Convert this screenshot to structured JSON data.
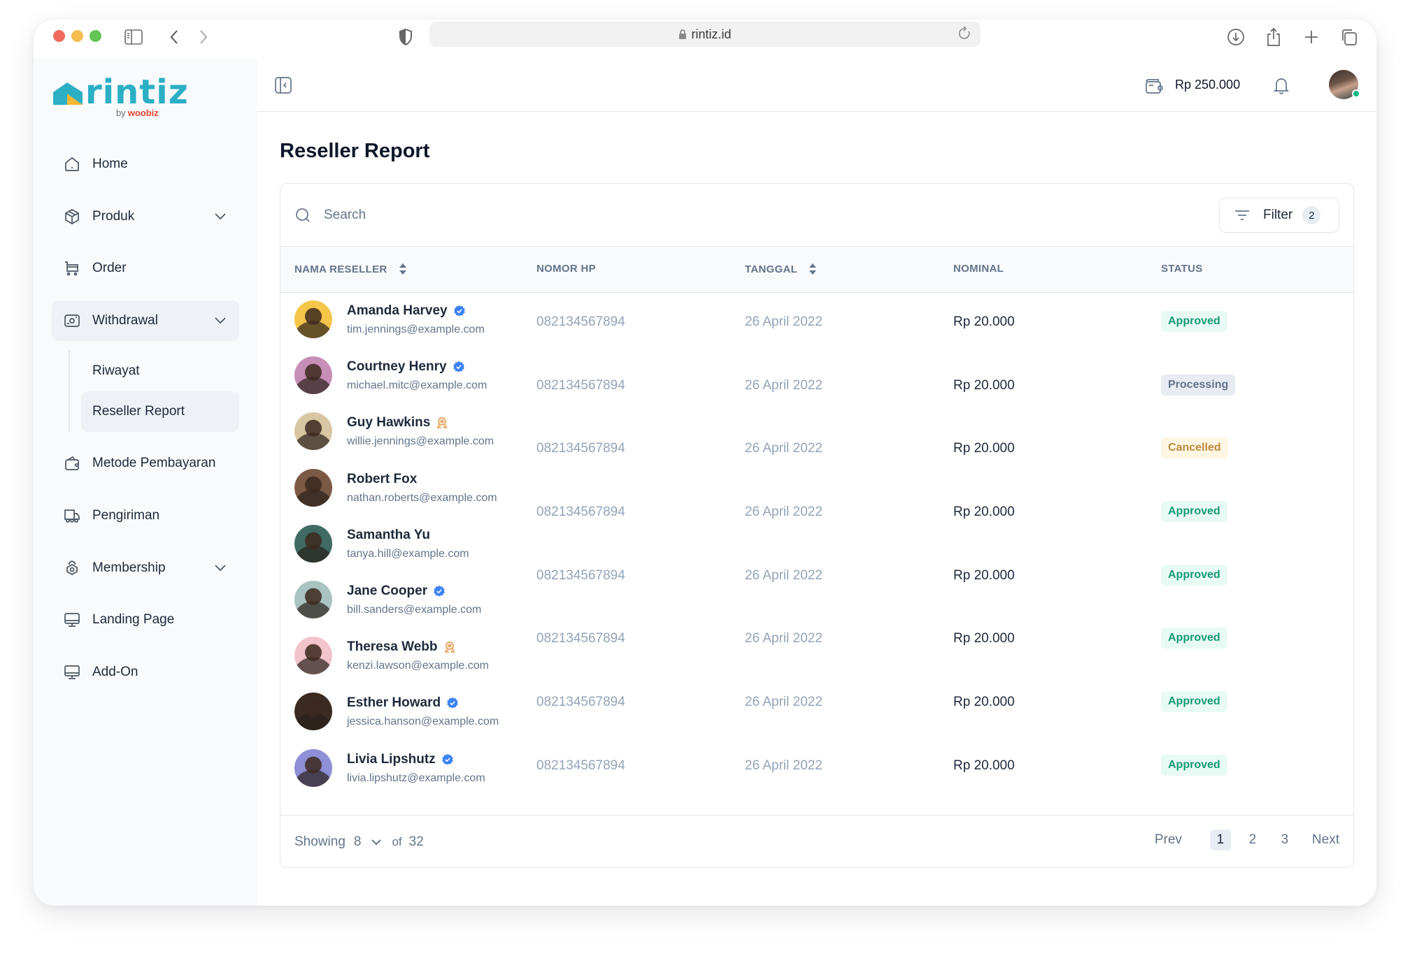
{
  "browser": {
    "url": "rintiz.id"
  },
  "brand": {
    "name": "rintiz",
    "by_label": "by",
    "by_brand": "woobiz",
    "colors": {
      "primary": "#2bafc5",
      "accent": "#f5b731",
      "by": "#e5432f"
    }
  },
  "sidebar": {
    "items": [
      {
        "label": "Home",
        "icon": "home-icon",
        "has_chevron": false
      },
      {
        "label": "Produk",
        "icon": "box-icon",
        "has_chevron": true
      },
      {
        "label": "Order",
        "icon": "cart-icon",
        "has_chevron": false
      },
      {
        "label": "Withdrawal",
        "icon": "camera-wallet-icon",
        "has_chevron": true,
        "expanded": true,
        "children": [
          {
            "label": "Riwayat"
          },
          {
            "label": "Reseller Report",
            "active": true
          }
        ]
      },
      {
        "label": "Metode Pembayaran",
        "icon": "wallet-icon",
        "has_chevron": false
      },
      {
        "label": "Pengiriman",
        "icon": "truck-icon",
        "has_chevron": false
      },
      {
        "label": "Membership",
        "icon": "membership-badge-icon",
        "has_chevron": true
      },
      {
        "label": "Landing Page",
        "icon": "monitor-icon",
        "has_chevron": false
      },
      {
        "label": "Add-On",
        "icon": "monitor-icon",
        "has_chevron": false
      }
    ]
  },
  "header": {
    "balance": "Rp 250.000",
    "online_status_color": "#10b981"
  },
  "page": {
    "title": "Reseller Report",
    "search_placeholder": "Search",
    "filter_label": "Filter",
    "filter_count": "2"
  },
  "table": {
    "columns": [
      {
        "label": "NAMA RESELLER",
        "sortable": true
      },
      {
        "label": "NOMOR HP",
        "sortable": false
      },
      {
        "label": "TANGGAL",
        "sortable": true
      },
      {
        "label": "NOMINAL",
        "sortable": false
      },
      {
        "label": "STATUS",
        "sortable": false
      }
    ],
    "resellers": [
      {
        "name": "Amanda Harvey",
        "email": "tim.jennings@example.com",
        "badge": "verified",
        "avatar_bg": "#f6c64a"
      },
      {
        "name": "Courtney Henry",
        "email": "michael.mitc@example.com",
        "badge": "verified",
        "avatar_bg": "#c78fb8"
      },
      {
        "name": "Guy Hawkins",
        "email": "willie.jennings@example.com",
        "badge": "award",
        "avatar_bg": "#d9c7a3"
      },
      {
        "name": "Robert Fox",
        "email": "nathan.roberts@example.com",
        "badge": "none",
        "avatar_bg": "#7a5a45"
      },
      {
        "name": "Samantha Yu",
        "email": "tanya.hill@example.com",
        "badge": "none",
        "avatar_bg": "#3f6b63"
      },
      {
        "name": "Jane Cooper",
        "email": "bill.sanders@example.com",
        "badge": "verified",
        "avatar_bg": "#a8c3c0"
      },
      {
        "name": "Theresa Webb",
        "email": "kenzi.lawson@example.com",
        "badge": "award",
        "avatar_bg": "#f2c4cc"
      },
      {
        "name": "Esther Howard",
        "email": "jessica.hanson@example.com",
        "badge": "verified",
        "avatar_bg": "#3a2a22"
      },
      {
        "name": "Livia Lipshutz",
        "email": "livia.lipshutz@example.com",
        "badge": "verified",
        "avatar_bg": "#8e8fd6"
      }
    ],
    "rows": [
      {
        "phone": "082134567894",
        "date": "26 April 2022",
        "nominal": "Rp 20.000",
        "status": "Approved",
        "status_type": "approved"
      },
      {
        "phone": "082134567894",
        "date": "26 April 2022",
        "nominal": "Rp 20.000",
        "status": "Processing",
        "status_type": "processing"
      },
      {
        "phone": "082134567894",
        "date": "26 April 2022",
        "nominal": "Rp 20.000",
        "status": "Cancelled",
        "status_type": "cancelled"
      },
      {
        "phone": "082134567894",
        "date": "26 April 2022",
        "nominal": "Rp 20.000",
        "status": "Approved",
        "status_type": "approved"
      },
      {
        "phone": "082134567894",
        "date": "26 April 2022",
        "nominal": "Rp 20.000",
        "status": "Approved",
        "status_type": "approved"
      },
      {
        "phone": "082134567894",
        "date": "26 April 2022",
        "nominal": "Rp 20.000",
        "status": "Approved",
        "status_type": "approved"
      },
      {
        "phone": "082134567894",
        "date": "26 April 2022",
        "nominal": "Rp 20.000",
        "status": "Approved",
        "status_type": "approved"
      },
      {
        "phone": "082134567894",
        "date": "26 April 2022",
        "nominal": "Rp 20.000",
        "status": "Approved",
        "status_type": "approved"
      }
    ]
  },
  "footer": {
    "showing_label": "Showing",
    "page_size": "8",
    "of_label": "of",
    "total": "32",
    "prev_label": "Prev",
    "next_label": "Next",
    "pages": [
      "1",
      "2",
      "3"
    ],
    "current_page": "1"
  },
  "status_colors": {
    "approved": {
      "bg": "#e8faf4",
      "fg": "#139a74"
    },
    "processing": {
      "bg": "#e8ebf2",
      "fg": "#64748b"
    },
    "cancelled": {
      "bg": "#fdf6e3",
      "fg": "#c08a3e"
    }
  }
}
